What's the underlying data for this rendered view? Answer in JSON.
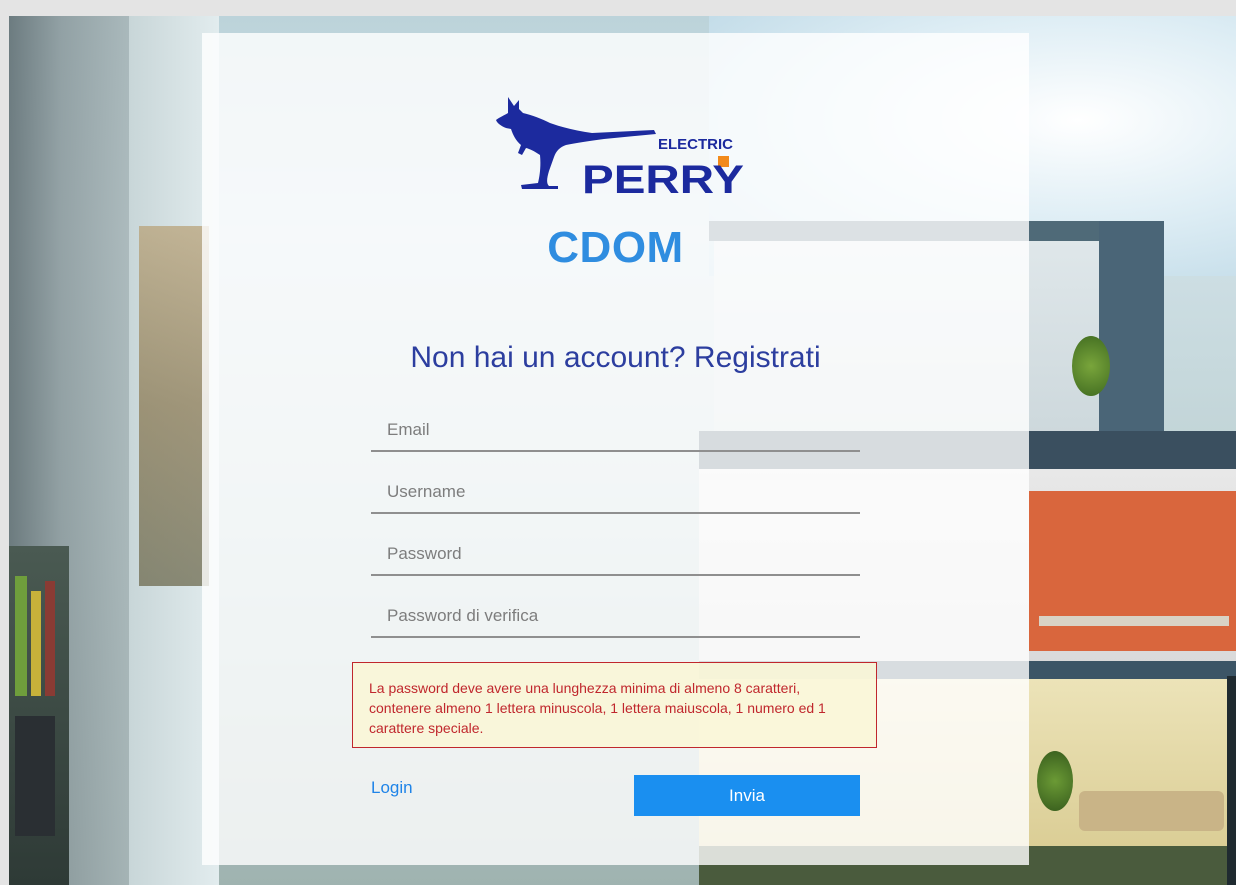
{
  "brand": {
    "logo_text_top": "ELECTRIC",
    "logo_text_main": "PERRY",
    "logo_colors": {
      "navy": "#1c2a9e",
      "orange": "#f28a1b"
    }
  },
  "app_title": "CDOM",
  "heading": "Non hai un account? Registrati",
  "form": {
    "email_placeholder": "Email",
    "username_placeholder": "Username",
    "password_placeholder": "Password",
    "password_confirm_placeholder": "Password di verifica"
  },
  "error_message": "La password deve avere una lunghezza minima di almeno 8 caratteri, contenere almeno 1 lettera minuscola, 1 lettera maiuscola, 1 numero ed 1 carattere speciale.",
  "login_link": "Login",
  "submit_button": "Invia",
  "colors": {
    "title": "#2f8de0",
    "heading": "#2c3e9f",
    "error": "#c0272d",
    "button": "#1a8ff0",
    "link": "#1f84e8"
  }
}
